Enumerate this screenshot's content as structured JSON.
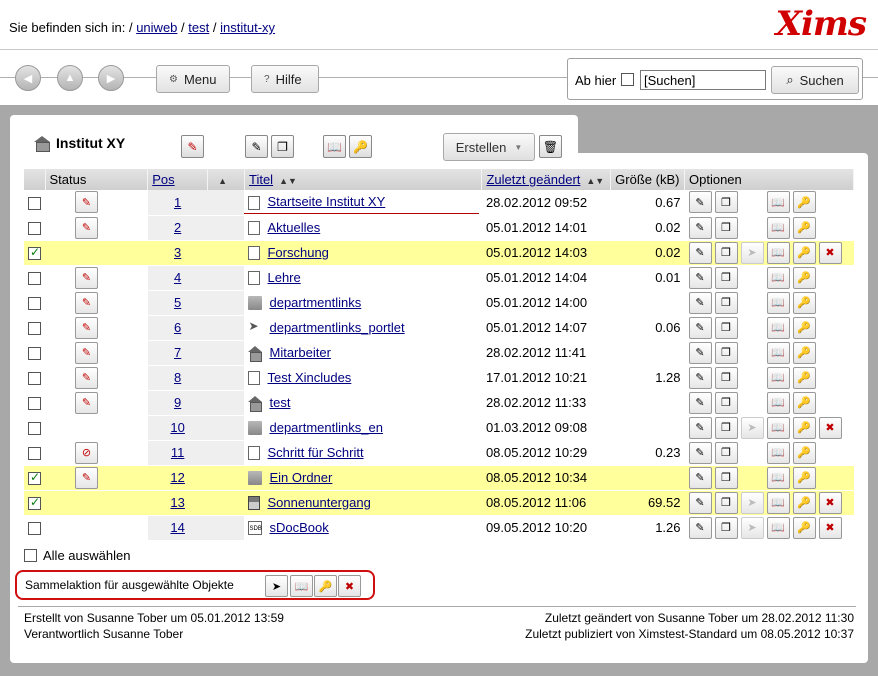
{
  "breadcrumb": {
    "prefix": "Sie befinden sich in: /",
    "items": [
      "uniweb",
      "test",
      "institut-xy"
    ],
    "sep": "/"
  },
  "logo": "Xims",
  "nav": {
    "menu_label": "Menu",
    "help_label": "Hilfe",
    "search_scope_label": "Ab hier",
    "search_value": "[Suchen]",
    "search_button": "Suchen"
  },
  "page": {
    "title": "Institut XY",
    "create_label": "Erstellen"
  },
  "table": {
    "headers": {
      "status": "Status",
      "pos": "Pos",
      "title": "Titel",
      "modified": "Zuletzt geändert",
      "size": "Größe (kB)",
      "options": "Optionen"
    },
    "rows": [
      {
        "checked": false,
        "status": "published",
        "pos": "1",
        "type": "document",
        "title": "Startseite Institut XY",
        "modified": "28.02.2012 09:52",
        "size": "0.67",
        "pub": false,
        "del": false
      },
      {
        "checked": false,
        "status": "published",
        "pos": "2",
        "type": "document",
        "title": "Aktuelles",
        "modified": "05.01.2012 14:01",
        "size": "0.02",
        "pub": false,
        "del": false
      },
      {
        "checked": true,
        "status": "",
        "pos": "3",
        "type": "document",
        "title": "Forschung",
        "modified": "05.01.2012 14:03",
        "size": "0.02",
        "pub": true,
        "del": true
      },
      {
        "checked": false,
        "status": "published",
        "pos": "4",
        "type": "document",
        "title": "Lehre",
        "modified": "05.01.2012 14:04",
        "size": "0.01",
        "pub": false,
        "del": false
      },
      {
        "checked": false,
        "status": "published",
        "pos": "5",
        "type": "folder",
        "title": "departmentlinks",
        "modified": "05.01.2012 14:00",
        "size": "",
        "pub": false,
        "del": false
      },
      {
        "checked": false,
        "status": "published",
        "pos": "6",
        "type": "portlet",
        "title": "departmentlinks_portlet",
        "modified": "05.01.2012 14:07",
        "size": "0.06",
        "pub": false,
        "del": false
      },
      {
        "checked": false,
        "status": "published",
        "pos": "7",
        "type": "house",
        "title": "Mitarbeiter",
        "modified": "28.02.2012 11:41",
        "size": "",
        "pub": false,
        "del": false
      },
      {
        "checked": false,
        "status": "published",
        "pos": "8",
        "type": "document",
        "title": "Test Xincludes",
        "modified": "17.01.2012 10:21",
        "size": "1.28",
        "pub": false,
        "del": false
      },
      {
        "checked": false,
        "status": "published",
        "pos": "9",
        "type": "house",
        "title": "test",
        "modified": "28.02.2012 11:33",
        "size": "",
        "pub": false,
        "del": false
      },
      {
        "checked": false,
        "status": "",
        "pos": "10",
        "type": "folder",
        "title": "departmentlinks_en",
        "modified": "01.03.2012 09:08",
        "size": "",
        "pub": true,
        "del": true
      },
      {
        "checked": false,
        "status": "outdated",
        "pos": "11",
        "type": "document",
        "title": "Schritt für Schritt",
        "modified": "08.05.2012 10:29",
        "size": "0.23",
        "pub": false,
        "del": false
      },
      {
        "checked": true,
        "status": "published",
        "pos": "12",
        "type": "folder",
        "title": "Ein Ordner",
        "modified": "08.05.2012 10:34",
        "size": "",
        "pub": false,
        "del": false
      },
      {
        "checked": true,
        "status": "",
        "pos": "13",
        "type": "picture",
        "title": "Sonnenuntergang",
        "modified": "08.05.2012 11:06",
        "size": "69.52",
        "pub": true,
        "del": true
      },
      {
        "checked": false,
        "status": "",
        "pos": "14",
        "type": "sdocbook",
        "title": "sDocBook",
        "modified": "09.05.2012 10:20",
        "size": "1.26",
        "pub": true,
        "del": true
      }
    ]
  },
  "select_all_label": "Alle auswählen",
  "bulk_action_label": "Sammelaktion für ausgewählte Objekte",
  "footer": {
    "created": "Erstellt von Susanne Tober um 05.01.2012 13:59",
    "responsible": "Verantwortlich Susanne Tober",
    "modified": "Zuletzt geändert von Susanne Tober um 28.02.2012 11:30",
    "published": "Zuletzt publiziert von Ximstest-Standard um 08.05.2012 10:37"
  },
  "colors": {
    "selected_row": "#ffff9c",
    "link": "#000080",
    "logo": "#d00000",
    "highlight_border": "#d01010"
  }
}
